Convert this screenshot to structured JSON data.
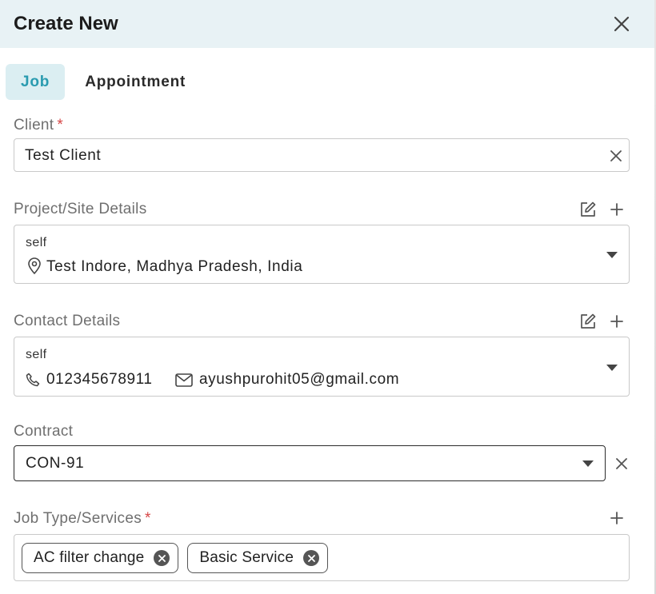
{
  "header": {
    "title": "Create New"
  },
  "tabs": [
    {
      "label": "Job",
      "active": true
    },
    {
      "label": "Appointment",
      "active": false
    }
  ],
  "client": {
    "label": "Client",
    "required_mark": "*",
    "value": "Test Client"
  },
  "project": {
    "label": "Project/Site Details",
    "name": "self",
    "address": "Test Indore, Madhya Pradesh, India"
  },
  "contact": {
    "label": "Contact Details",
    "name": "self",
    "phone": "012345678911",
    "email": "ayushpurohit05@gmail.com"
  },
  "contract": {
    "label": "Contract",
    "value": "CON-91"
  },
  "job_type": {
    "label": "Job Type/Services",
    "required_mark": "*",
    "chips": [
      "AC filter change",
      "Basic Service"
    ]
  },
  "colors": {
    "header_bg": "#e8f2f5",
    "active_tab_bg": "#dbeef2",
    "active_tab_text": "#2a9bb0",
    "required": "#d64545"
  }
}
